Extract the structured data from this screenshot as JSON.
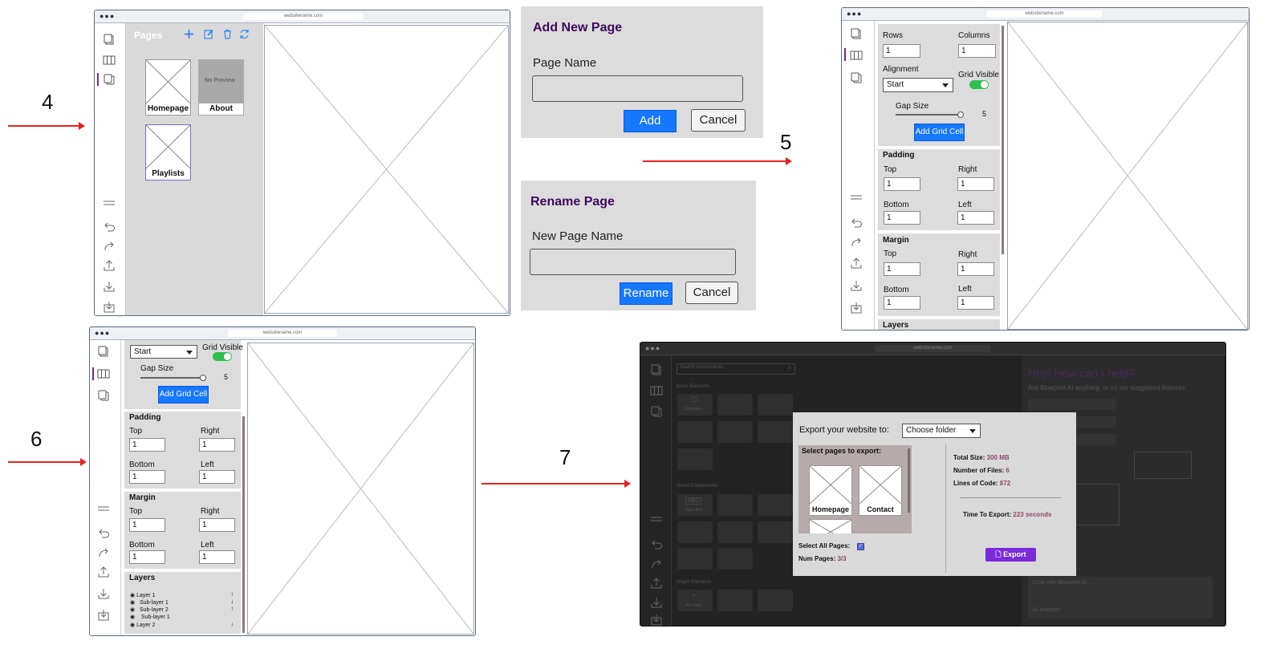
{
  "step_numbers": [
    "4",
    "5",
    "6",
    "7"
  ],
  "browser": {
    "url": "websitename.com"
  },
  "step4": {
    "panel_title": "Pages",
    "pages": [
      {
        "name": "Homepage",
        "preview": ""
      },
      {
        "name": "About",
        "preview": "No Preview"
      },
      {
        "name": "Playlists",
        "preview": ""
      }
    ]
  },
  "add_dialog": {
    "title": "Add New Page",
    "field_label": "Page Name",
    "input_value": "",
    "confirm": "Add",
    "cancel": "Cancel"
  },
  "rename_dialog": {
    "title": "Rename Page",
    "field_label": "New Page Name",
    "input_value": "",
    "confirm": "Rename",
    "cancel": "Cancel"
  },
  "step5": {
    "rows_label": "Rows",
    "rows_value": "1",
    "columns_label": "Columns",
    "columns_value": "1",
    "alignment_label": "Alignment",
    "alignment_value": "Start",
    "grid_visible_label": "Grid Visible",
    "gap_label": "Gap Size",
    "gap_value": "5",
    "add_cell_button": "Add Grid Cell",
    "padding": {
      "title": "Padding",
      "top": "Top",
      "right": "Right",
      "bottom": "Bottom",
      "left": "Left",
      "values": [
        "1",
        "1",
        "1",
        "1"
      ]
    },
    "margin": {
      "title": "Margin",
      "top": "Top",
      "right": "Right",
      "bottom": "Bottom",
      "left": "Left",
      "values": [
        "1",
        "1",
        "1",
        "1"
      ]
    },
    "layers_title": "Layers"
  },
  "step6": {
    "alignment_value": "Start",
    "grid_visible_label": "Grid Visible",
    "gap_label": "Gap Size",
    "gap_value": "5",
    "add_cell_button": "Add Grid Cell",
    "padding": {
      "title": "Padding",
      "top": "Top",
      "right": "Right",
      "bottom": "Bottom",
      "left": "Left",
      "values": [
        "1",
        "1",
        "1",
        "1"
      ]
    },
    "margin": {
      "title": "Margin",
      "top": "Top",
      "right": "Right",
      "bottom": "Bottom",
      "left": "Left",
      "values": [
        "1",
        "1",
        "1",
        "1"
      ]
    },
    "layers_title": "Layers",
    "layers": [
      "Layer 1",
      "Sub-layer 1",
      "Sub-layer 2",
      "Sub-layer 1",
      "Layer 2"
    ]
  },
  "step7": {
    "search_placeholder": "Search components...",
    "basic_elements": "Basic Elements",
    "container": "Container",
    "smart_components": "Smart Components",
    "abc": "ABC",
    "input_box": "Input Box",
    "graph_elements": "Graph Elements",
    "pie_chart": "Pie Chart",
    "ai_heading": "Hey! How can I help?",
    "ai_sub": "Ask Blueprint AI anything, or try our suggested features.",
    "ai_chat_placeholder": "Chat with Blueprint AI...",
    "ai_features": "AI features",
    "export": {
      "label": "Export your website to:",
      "folder": "Choose folder",
      "select_pages": "Select pages to export:",
      "pages": [
        "Homepage",
        "Contact"
      ],
      "select_all": "Select All Pages:",
      "num_pages_label": "Num Pages:",
      "num_pages_value": "3/3",
      "total_size_label": "Total Size:",
      "total_size_value": "300 MB",
      "num_files_label": "Number of Files:",
      "num_files_value": "6",
      "loc_label": "Lines of Code:",
      "loc_value": "872",
      "time_label": "Time To Export:",
      "time_value": "223 seconds",
      "button": "Export"
    }
  }
}
